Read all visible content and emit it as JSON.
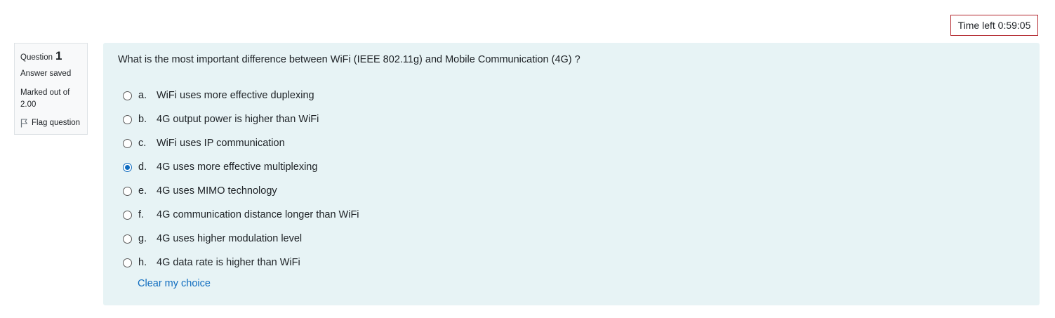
{
  "timer": {
    "label": "Time left",
    "value": "0:59:05"
  },
  "question_info": {
    "question_label": "Question",
    "question_number": "1",
    "state": "Answer saved",
    "grade": "Marked out of 2.00",
    "flag_label": "Flag question"
  },
  "question": {
    "text": "What is the most important difference between WiFi (IEEE 802.11g) and Mobile Communication (4G) ?",
    "selected": "d",
    "answers": [
      {
        "letter": "a.",
        "text": "WiFi uses more effective duplexing",
        "checked": false
      },
      {
        "letter": "b.",
        "text": "4G output power is higher than WiFi",
        "checked": false
      },
      {
        "letter": "c.",
        "text": "WiFi uses IP communication",
        "checked": false
      },
      {
        "letter": "d.",
        "text": "4G uses more effective multiplexing",
        "checked": true
      },
      {
        "letter": "e.",
        "text": "4G uses MIMO technology",
        "checked": false
      },
      {
        "letter": "f.",
        "text": "4G communication distance longer than WiFi",
        "checked": false
      },
      {
        "letter": "g.",
        "text": "4G uses higher modulation level",
        "checked": false
      },
      {
        "letter": "h.",
        "text": "4G data rate is higher than WiFi",
        "checked": false
      }
    ],
    "clear_label": "Clear my choice"
  },
  "colors": {
    "timer_border": "#b3272d",
    "content_bg": "#e7f3f5",
    "link": "#0f6cbf",
    "radio_selected": "#0f6cbf"
  },
  "icons": {
    "flag": "flag-icon"
  }
}
